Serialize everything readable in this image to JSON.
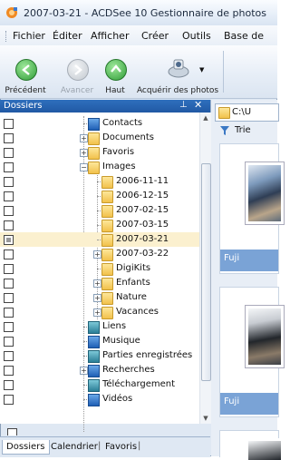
{
  "window": {
    "title": "2007-03-21 - ACDSee 10 Gestionnaire de photos"
  },
  "menu": [
    "Fichier",
    "Éditer",
    "Afficher",
    "Créer",
    "Outils",
    "Base de"
  ],
  "toolbar": {
    "back": "Précédent",
    "forward": "Avancer",
    "up": "Haut",
    "acquire": "Acquérir des photos"
  },
  "panel": {
    "title": "Dossiers",
    "tree": [
      {
        "label": "Contacts",
        "icon": "contacts-icon"
      },
      {
        "label": "Documents",
        "icon": "documents-icon",
        "expander": "+"
      },
      {
        "label": "Favoris",
        "icon": "favorites-icon",
        "expander": "+"
      },
      {
        "label": "Images",
        "icon": "images-icon",
        "expander": "−"
      },
      {
        "label": "2006-11-11",
        "icon": "folder-icon"
      },
      {
        "label": "2006-12-15",
        "icon": "folder-icon"
      },
      {
        "label": "2007-02-15",
        "icon": "folder-icon"
      },
      {
        "label": "2007-03-15",
        "icon": "folder-icon"
      },
      {
        "label": "2007-03-21",
        "icon": "folder-icon",
        "selected": true
      },
      {
        "label": "2007-03-22",
        "icon": "folder-icon",
        "expander": "+"
      },
      {
        "label": "DigiKits",
        "icon": "folder-icon"
      },
      {
        "label": "Enfants",
        "icon": "folder-icon",
        "expander": "+"
      },
      {
        "label": "Nature",
        "icon": "folder-icon",
        "expander": "+"
      },
      {
        "label": "Vacances",
        "icon": "folder-icon",
        "expander": "+"
      },
      {
        "label": "Liens",
        "icon": "links-icon"
      },
      {
        "label": "Musique",
        "icon": "music-icon"
      },
      {
        "label": "Parties enregistrées",
        "icon": "saved-games-icon"
      },
      {
        "label": "Recherches",
        "icon": "searches-icon",
        "expander": "+"
      },
      {
        "label": "Téléchargement",
        "icon": "downloads-icon"
      },
      {
        "label": "Vidéos",
        "icon": "videos-icon"
      }
    ],
    "tabs": [
      "Dossiers",
      "Calendrier",
      "Favoris"
    ]
  },
  "browser": {
    "path": "C:\\U",
    "sort": "Trie",
    "captions": [
      "Fuji",
      "Fuji"
    ]
  },
  "colors": {
    "panel_header": "#2a64b0",
    "selection": "#fbf0cf",
    "caption_bar": "#7aa3d6"
  }
}
